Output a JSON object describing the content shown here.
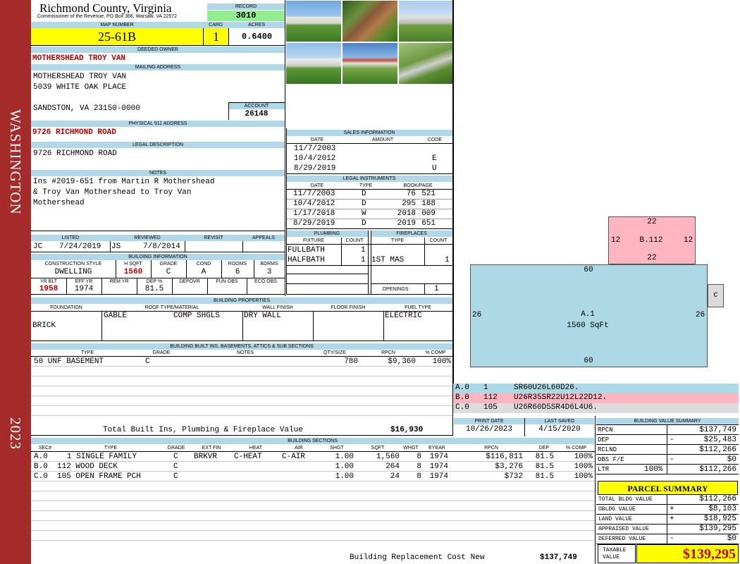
{
  "side": {
    "top": "WASHINGTON",
    "bottom": "2023"
  },
  "header": {
    "county": "Richmond County, Virginia",
    "commissioner": "Commissioner of the Revenue, PO Box 366, Warsaw, VA 22572",
    "record_label": "RECORD",
    "record": "3010",
    "map_label": "MAP NUMBER",
    "map": "25-61B",
    "card_label": "CARD",
    "card": "1",
    "acres_label": "ACRES",
    "acres": "0.6400"
  },
  "owner": {
    "label": "DEEDED OWNER",
    "name": "MOTHERSHEAD TROY VAN",
    "mailing_label": "MAILING ADDRESS",
    "mail1": "MOTHERSHEAD TROY VAN",
    "mail2": "5039 WHITE OAK PLACE",
    "mail3": "SANDSTON, VA 23150-0000",
    "account_label": "ACCOUNT",
    "account": "26148"
  },
  "address": {
    "label": "PHYSICAL 911 ADDRESS",
    "value": "9726 RICHMOND ROAD"
  },
  "legal": {
    "label": "LEGAL DESCRIPTION",
    "value": "9726 RICHMOND ROAD"
  },
  "notes": {
    "label": "NOTES",
    "l1": "Ins #2019-651 from Martin R Mothershead",
    "l2": "& Troy Van Mothershead to Troy Van",
    "l3": "Mothershead"
  },
  "listed": {
    "listed_label": "LISTED",
    "reviewed_label": "REVIEWED",
    "revisit_label": "REVISIT",
    "appeals_label": "APPEALS",
    "lby": "JC",
    "ldate": "7/24/2019",
    "rby": "JS",
    "rdate": "7/8/2014"
  },
  "bldg": {
    "label": "BUILDING INFORMATION",
    "h_cs": "CONSTRUCTION STYLE",
    "h_sqft": "H SQFT",
    "h_grade": "GRADE",
    "h_cond": "COND",
    "h_rooms": "ROOMS",
    "h_bdrms": "BDRMS",
    "cs": "DWELLING",
    "sqft": "1560",
    "grade": "C",
    "cond": "A",
    "rooms": "6",
    "bdrms": "3",
    "h_yb": "YR BLT",
    "h_ey": "EFF YR",
    "h_ry": "REM YR",
    "h_dep": "DEP %",
    "h_depovr": "DEPOVR",
    "h_fun": "FUN OBS",
    "h_eco": "ECO OBS",
    "yb": "1958",
    "ey": "1974",
    "dep": "81.5"
  },
  "sales": {
    "label": "SALES INFORMATION",
    "h_date": "DATE",
    "h_amount": "AMOUNT",
    "h_code": "CODE",
    "rows": [
      {
        "date": "11/7/2003",
        "code": ""
      },
      {
        "date": "10/4/2012",
        "code": "E"
      },
      {
        "date": "8/29/2019",
        "code": "U"
      }
    ]
  },
  "instruments": {
    "label": "LEGAL INSTRUMENTS",
    "h_date": "DATE",
    "h_type": "TYPE",
    "h_bp": "BOOK/PAGE",
    "rows": [
      {
        "date": "11/7/2003",
        "type": "D",
        "book": "76",
        "page": "521"
      },
      {
        "date": "10/4/2012",
        "type": "D",
        "book": "295",
        "page": "188"
      },
      {
        "date": "1/17/2018",
        "type": "W",
        "book": "2018",
        "page": "009"
      },
      {
        "date": "8/29/2019",
        "type": "D",
        "book": "2019",
        "page": "651"
      }
    ]
  },
  "plumbing": {
    "label": "PLUMBING",
    "h_fix": "FIXTURE",
    "h_count": "COUNT",
    "r1": "FULLBATH",
    "c1": "1",
    "r2": "HALFBATH",
    "c2": "1"
  },
  "fireplaces": {
    "label": "FIREPLACES",
    "h_type": "TYPE",
    "h_count": "COUNT",
    "r1": "1ST MAS",
    "c1": "1",
    "openings_label": "OPENINGS",
    "openings": "1"
  },
  "props": {
    "label": "BUILDING PROPERTIES",
    "h_found": "FOUNDATION",
    "h_roof": "ROOF TYPE/MATERIAL",
    "h_wall": "WALL FINISH",
    "h_floor": "FLOOR FINISH",
    "h_fuel": "FUEL TYPE",
    "found": "BRICK",
    "roof1": "GABLE",
    "roof2": "COMP SHGLS",
    "wall": "DRY WALL",
    "fuel": "ELECTRIC"
  },
  "builtins": {
    "label": "BUILDING BUILT INS, BASEMENTS, ATTICS & SUB SECTIONS",
    "h_type": "TYPE",
    "h_grade": "GRADE",
    "h_notes": "NOTES",
    "h_qty": "QTY/SIZE",
    "h_rpcn": "RPCN",
    "h_comp": "% COMP",
    "type": "50 UNF BASEMENT",
    "grade": "C",
    "qty": "780",
    "rpcn": "$9,360",
    "comp": "100%",
    "total_label": "Total Built Ins, Plumbing & Fireplace Value",
    "total": "$16,930"
  },
  "dates": {
    "print_label": "PRINT DATE",
    "saved_label": "LAST SAVED",
    "print": "10/26/2023",
    "saved": "4/15/2020"
  },
  "sections": {
    "label": "BUILDING SECTIONS",
    "h_sec": "SEC#",
    "h_type": "TYPE",
    "h_grade": "GRADE",
    "h_ext": "EXT FIN",
    "h_heat": "HEAT",
    "h_air": "AIR",
    "h_shgt": "SHGT",
    "h_sqft": "SQFT",
    "h_whgt": "WHGT",
    "h_eyear": "EYEAR",
    "h_rpcn": "RPCN",
    "h_dep": "DEP",
    "h_comp": "% COMP",
    "rows": [
      {
        "sec": "A.0",
        "type": "1 SINGLE FAMILY",
        "grade": "C",
        "ext": "BRKVR",
        "heat": "C-HEAT",
        "air": "C-AIR",
        "shgt": "1.00",
        "sqft": "1,560",
        "whgt": "8",
        "eyear": "1974",
        "rpcn": "$116,811",
        "dep": "81.5",
        "comp": "100%"
      },
      {
        "sec": "B.0",
        "type": "112 WOOD DECK",
        "grade": "C",
        "ext": "",
        "heat": "",
        "air": "",
        "shgt": "1.00",
        "sqft": "264",
        "whgt": "8",
        "eyear": "1974",
        "rpcn": "$3,276",
        "dep": "81.5",
        "comp": "100%"
      },
      {
        "sec": "C.0",
        "type": "105 OPEN FRAME PCH",
        "grade": "C",
        "ext": "",
        "heat": "",
        "air": "",
        "shgt": "1.00",
        "sqft": "24",
        "whgt": "8",
        "eyear": "1974",
        "rpcn": "$732",
        "dep": "81.5",
        "comp": "100%"
      }
    ],
    "rcn_label": "Building Replacement Cost New",
    "rcn": "$137,749"
  },
  "sketch": {
    "b_top": "22",
    "b_left": "12",
    "b_label": "B.112",
    "b_right": "12",
    "b_bottom": "22",
    "a_top": "60",
    "a_left": "26",
    "a_label": "A.1",
    "a_sqft": "1560 SqFt",
    "a_right": "26",
    "a_bottom": "60",
    "c_label": "C",
    "vectors": [
      {
        "id": "A.0",
        "code": "1",
        "vec": "SR60U26L60D26."
      },
      {
        "id": "B.0",
        "code": "112",
        "vec": "U26R35SR22U12L22D12."
      },
      {
        "id": "C.0",
        "code": "105",
        "vec": "U26R60D5SR4D6L4U6."
      }
    ]
  },
  "summary": {
    "label": "BUILDING VALUE SUMMARY",
    "rpcn_l": "RPCN",
    "rpcn": "$137,749",
    "dep_l": "DEP",
    "dep_s": "-",
    "dep": "$25,483",
    "rclnd_l": "RCLND",
    "rclnd": "$112,266",
    "obs_l": "OBS F/E",
    "obs_s": "-",
    "obs": "$0",
    "ltr_l": "LTR",
    "ltr_p": "100%",
    "ltr": "$112,266"
  },
  "parcel": {
    "label": "PARCEL SUMMARY",
    "tb_l": "TOTAL BLDG VALUE",
    "tb": "$112,266",
    "ob_l": "OBLDG VALUE",
    "ob_s": "+",
    "ob": "$8,103",
    "lv_l": "LAND VALUE",
    "lv_s": "+",
    "lv": "$18,925",
    "av_l": "APPRAISED VALUE",
    "av": "$139,295",
    "dv_l": "DEFERRED VALUE",
    "dv_s": "-",
    "dv": "$0",
    "tv_l1": "TAXABLE",
    "tv_l2": "VALUE",
    "tv": "$139,295"
  },
  "colors": {
    "band": "#a52a2a",
    "header": "#b0d8e8",
    "yellow": "#ffff00",
    "green": "#90ee90",
    "pink": "#ffb6c1",
    "blue": "#add8e6"
  }
}
